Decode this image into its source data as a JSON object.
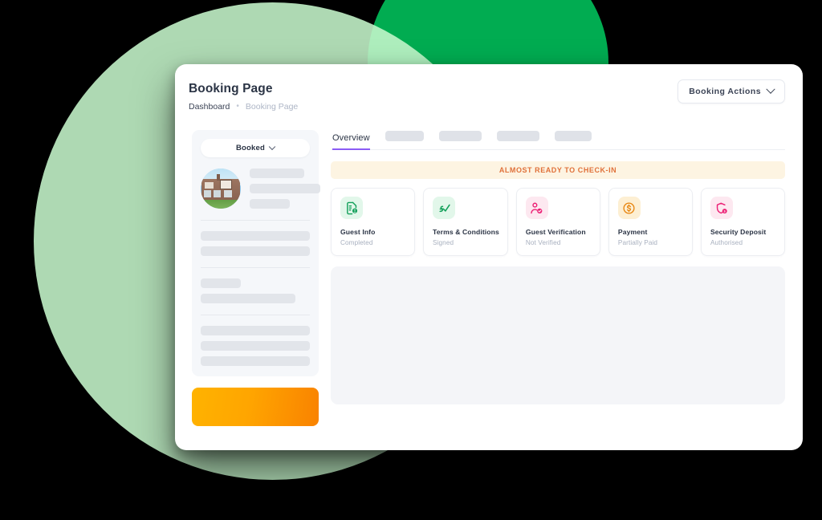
{
  "header": {
    "title": "Booking Page",
    "breadcrumb": {
      "root": "Dashboard",
      "separator": "•",
      "current": "Booking Page"
    },
    "actions_button": {
      "label": "Booking Actions",
      "icon": "chevron-down-icon"
    }
  },
  "sidebar": {
    "status_dropdown": {
      "label": "Booked",
      "icon": "chevron-down-icon"
    },
    "property_photo": "tudor-house-photo",
    "cta_button_label": ""
  },
  "main": {
    "tabs": [
      {
        "label": "Overview",
        "active": true
      },
      {
        "label": "",
        "active": false
      },
      {
        "label": "",
        "active": false
      },
      {
        "label": "",
        "active": false
      },
      {
        "label": "",
        "active": false
      }
    ],
    "banner": {
      "text": "ALMOST READY TO CHECK-IN",
      "bg_color": "#fdf4e2",
      "text_color": "#e0713a"
    },
    "status_cards": [
      {
        "title": "Guest Info",
        "status": "Completed",
        "icon": "document-person-icon",
        "icon_color": "#13a05a",
        "icon_bg": "#e2f7ea",
        "tone": "green"
      },
      {
        "title": "Terms & Conditions",
        "status": "Signed",
        "icon": "signature-check-icon",
        "icon_color": "#13a05a",
        "icon_bg": "#e2f7ea",
        "tone": "green"
      },
      {
        "title": "Guest Verification",
        "status": "Not Verified",
        "icon": "person-check-icon",
        "icon_color": "#ec1e74",
        "icon_bg": "#fde8f0",
        "tone": "pink"
      },
      {
        "title": "Payment",
        "status": "Partially Paid",
        "icon": "dollar-coin-icon",
        "icon_color": "#e8850f",
        "icon_bg": "#fdefd3",
        "tone": "amber"
      },
      {
        "title": "Security Deposit",
        "status": "Authorised",
        "icon": "shield-dollar-icon",
        "icon_color": "#ec1e74",
        "icon_bg": "#fde8f0",
        "tone": "pink"
      }
    ]
  },
  "theme": {
    "accent_tab": "#8b5cf6",
    "cta_gradient_start": "#ffb300",
    "cta_gradient_end": "#f98200",
    "bg_circle_light": "#c6f7cc",
    "bg_circle_dark": "#01ac51",
    "page_background": "#000000"
  }
}
